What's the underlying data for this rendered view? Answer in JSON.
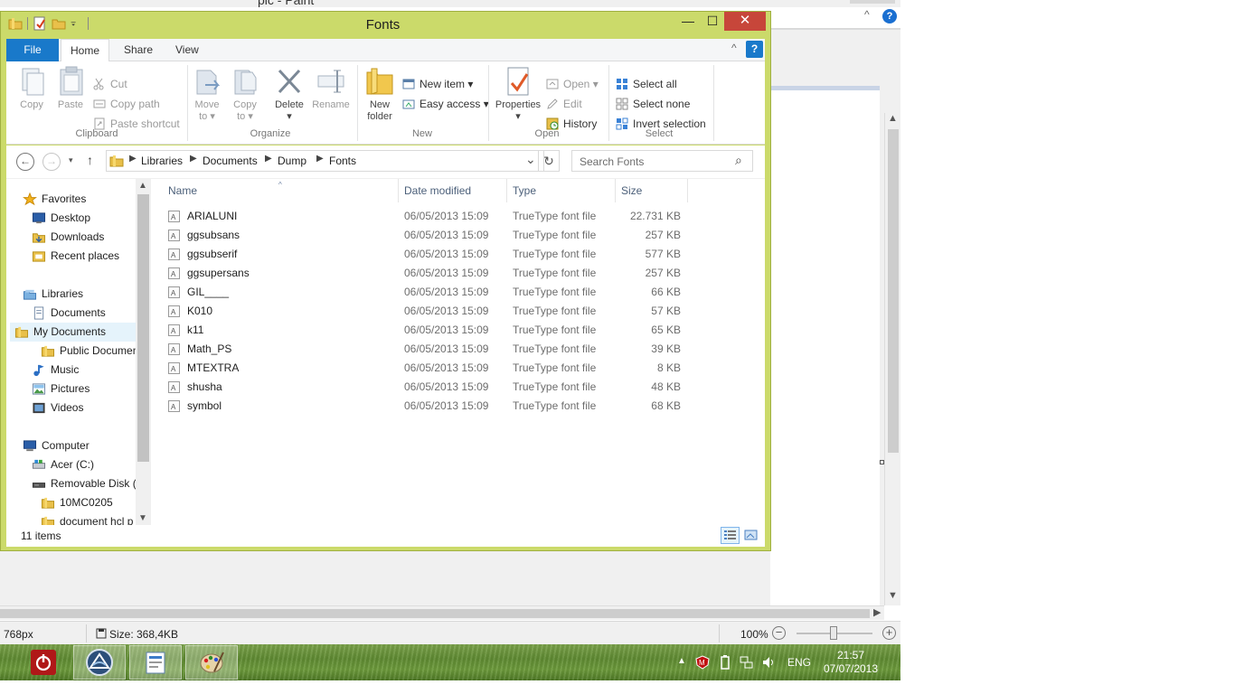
{
  "paint": {
    "title": "pic - Paint",
    "status_dimension": "768px",
    "status_size": "Size: 368,4KB",
    "zoom": "100%",
    "zoom_out": "−",
    "zoom_in": "+",
    "help": "?",
    "collapse": "^"
  },
  "explorer": {
    "title": "Fonts",
    "window_controls": {
      "minimize": "—",
      "maximize": "☐",
      "close": "✕"
    },
    "tabs": {
      "file": "File",
      "home": "Home",
      "share": "Share",
      "view": "View"
    },
    "help": "?",
    "collapse": "^",
    "ribbon": {
      "clipboard": {
        "label": "Clipboard",
        "copy": "Copy",
        "paste": "Paste",
        "cut": "Cut",
        "copy_path": "Copy path",
        "paste_shortcut": "Paste shortcut"
      },
      "organize": {
        "label": "Organize",
        "move_to": "Move",
        "move_to_2": "to ▾",
        "copy_to": "Copy",
        "copy_to_2": "to ▾",
        "delete": "Delete",
        "delete_2": "▾",
        "rename": "Rename"
      },
      "new": {
        "label": "New",
        "new_folder": "New",
        "new_folder_2": "folder",
        "new_item": "New item ▾",
        "easy_access": "Easy access ▾"
      },
      "open": {
        "label": "Open",
        "properties": "Properties",
        "properties_2": "▾",
        "open": "Open ▾",
        "edit": "Edit",
        "history": "History"
      },
      "select": {
        "label": "Select",
        "select_all": "Select all",
        "select_none": "Select none",
        "invert_selection": "Invert selection"
      }
    },
    "nav": {
      "back": "←",
      "forward": "→",
      "recent": "▾",
      "up": "↑"
    },
    "breadcrumb": [
      "Libraries",
      "Documents",
      "Dump",
      "Fonts"
    ],
    "breadcrumb_sep": "▶",
    "address_dropdown": "⌄",
    "refresh": "↻",
    "search": {
      "placeholder": "Search Fonts",
      "icon": "⌕"
    },
    "navpane": [
      {
        "label": "Favorites",
        "icon": "star-icon"
      },
      {
        "label": "Desktop",
        "icon": "desktop-icon"
      },
      {
        "label": "Downloads",
        "icon": "downloads-icon"
      },
      {
        "label": "Recent places",
        "icon": "recent-places-icon"
      },
      {
        "label": "Libraries",
        "icon": "libraries-icon"
      },
      {
        "label": "Documents",
        "icon": "documents-icon"
      },
      {
        "label": "My Documents",
        "icon": "folder-icon"
      },
      {
        "label": "Public Documents",
        "icon": "folder-icon"
      },
      {
        "label": "Music",
        "icon": "music-icon"
      },
      {
        "label": "Pictures",
        "icon": "pictures-icon"
      },
      {
        "label": "Videos",
        "icon": "videos-icon"
      },
      {
        "label": "Computer",
        "icon": "computer-icon"
      },
      {
        "label": "Acer (C:)",
        "icon": "drive-icon"
      },
      {
        "label": "Removable Disk (",
        "icon": "removable-disk-icon"
      },
      {
        "label": "10MC0205",
        "icon": "folder-icon"
      },
      {
        "label": "document hcl p",
        "icon": "folder-icon"
      }
    ],
    "columns": {
      "name": "Name",
      "date": "Date modified",
      "type": "Type",
      "size": "Size"
    },
    "sort_indicator": "^",
    "files": [
      {
        "name": "ARIALUNI",
        "date": "06/05/2013 15:09",
        "type": "TrueType font file",
        "size": "22.731 KB"
      },
      {
        "name": "ggsubsans",
        "date": "06/05/2013 15:09",
        "type": "TrueType font file",
        "size": "257 KB"
      },
      {
        "name": "ggsubserif",
        "date": "06/05/2013 15:09",
        "type": "TrueType font file",
        "size": "577 KB"
      },
      {
        "name": "ggsupersans",
        "date": "06/05/2013 15:09",
        "type": "TrueType font file",
        "size": "257 KB"
      },
      {
        "name": "GIL____",
        "date": "06/05/2013 15:09",
        "type": "TrueType font file",
        "size": "66 KB"
      },
      {
        "name": "K010",
        "date": "06/05/2013 15:09",
        "type": "TrueType font file",
        "size": "57 KB"
      },
      {
        "name": "k11",
        "date": "06/05/2013 15:09",
        "type": "TrueType font file",
        "size": "65 KB"
      },
      {
        "name": "Math_PS",
        "date": "06/05/2013 15:09",
        "type": "TrueType font file",
        "size": "39 KB"
      },
      {
        "name": "MTEXTRA",
        "date": "06/05/2013 15:09",
        "type": "TrueType font file",
        "size": "8 KB"
      },
      {
        "name": "shusha",
        "date": "06/05/2013 15:09",
        "type": "TrueType font file",
        "size": "48 KB"
      },
      {
        "name": "symbol",
        "date": "06/05/2013 15:09",
        "type": "TrueType font file",
        "size": "68 KB"
      }
    ],
    "status": {
      "item_count": "11 items"
    }
  },
  "taskbar": {
    "language": "ENG",
    "time": "21:57",
    "date": "07/07/2013",
    "show_hidden": "▲"
  },
  "colors": {
    "explorer_frame": "#cbda6a",
    "file_tab": "#1979ca",
    "close_button": "#c7463a",
    "taskbar": "#6c9a3b"
  }
}
